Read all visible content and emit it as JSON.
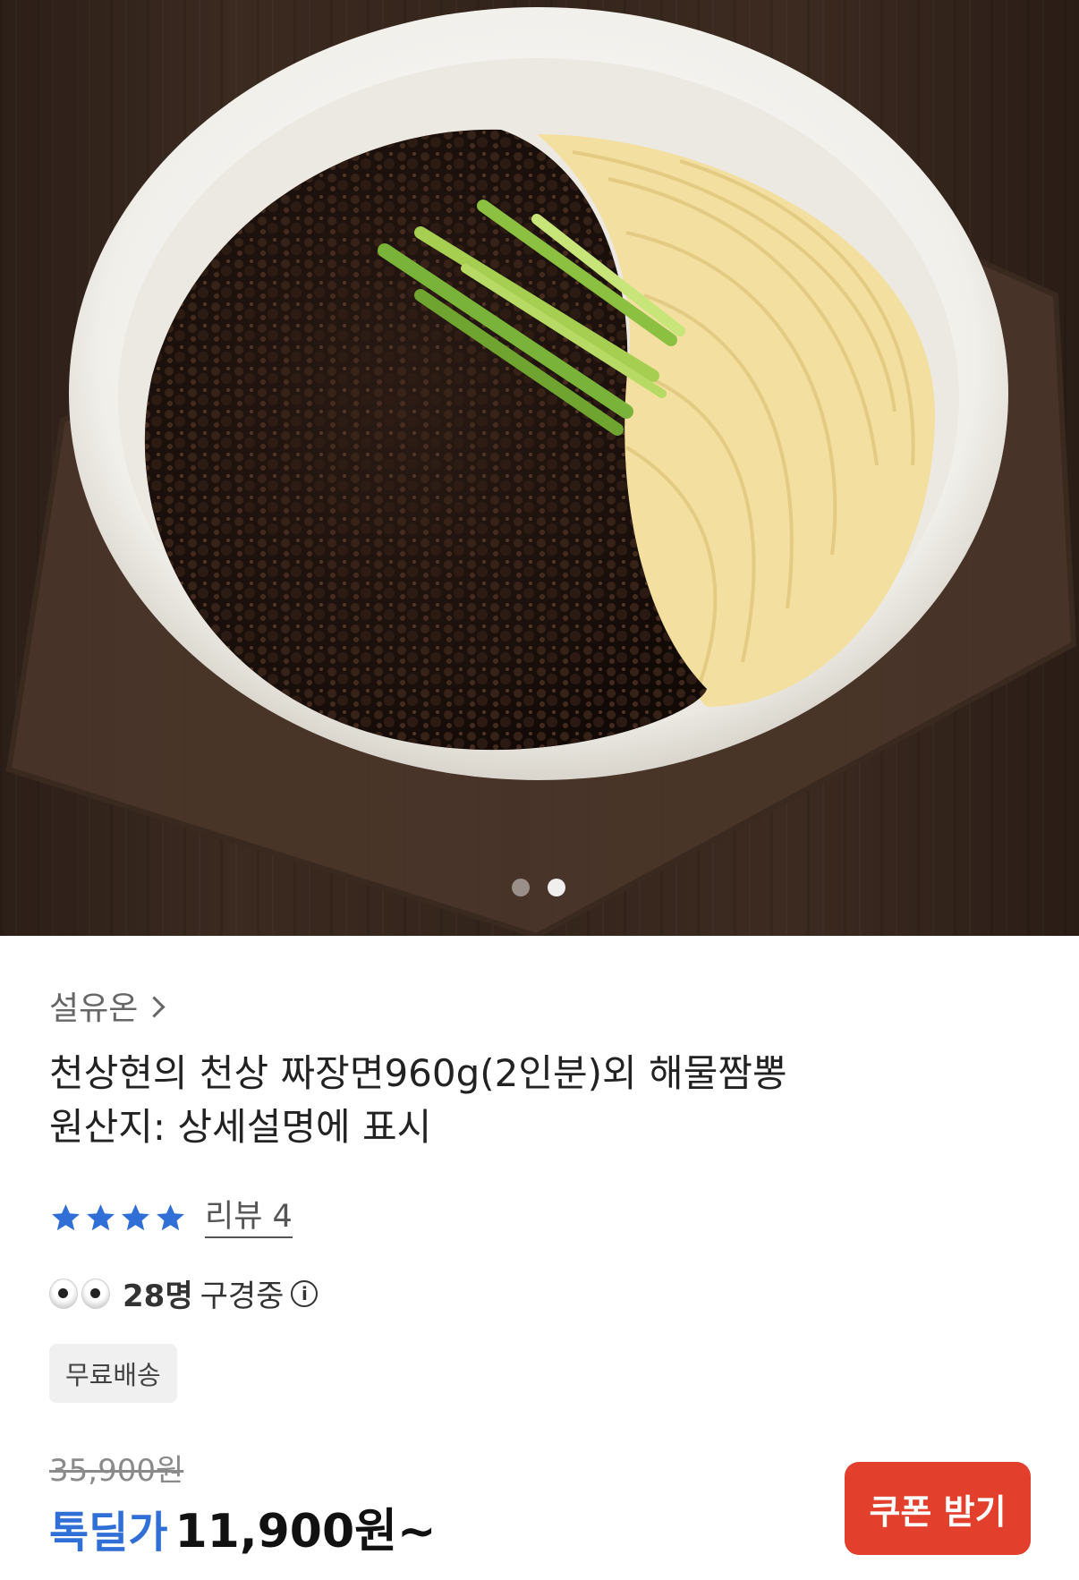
{
  "product": {
    "seller": "설유온",
    "title_line1": "천상현의 천상 짜장면960g(2인분)외 해물짬뽕",
    "title_line2": "원산지: 상세설명에 표시",
    "rating_stars": 4,
    "review_text": "리뷰 4",
    "viewers_count": "28명",
    "viewers_text": "구경중",
    "badge": "무료배송",
    "original_price": "35,900원",
    "deal_label": "톡딜가",
    "deal_price": "11,900원~"
  },
  "actions": {
    "coupon_label": "쿠폰 받기"
  },
  "carousel": {
    "total": 2,
    "active_index": 1
  },
  "colors": {
    "accent_blue": "#2f6fd6",
    "coupon_red": "#e2402c",
    "star_blue": "#2f6fd6"
  },
  "icons": [
    "chevron-right-icon",
    "star-icon",
    "eyes-icon",
    "info-icon"
  ]
}
